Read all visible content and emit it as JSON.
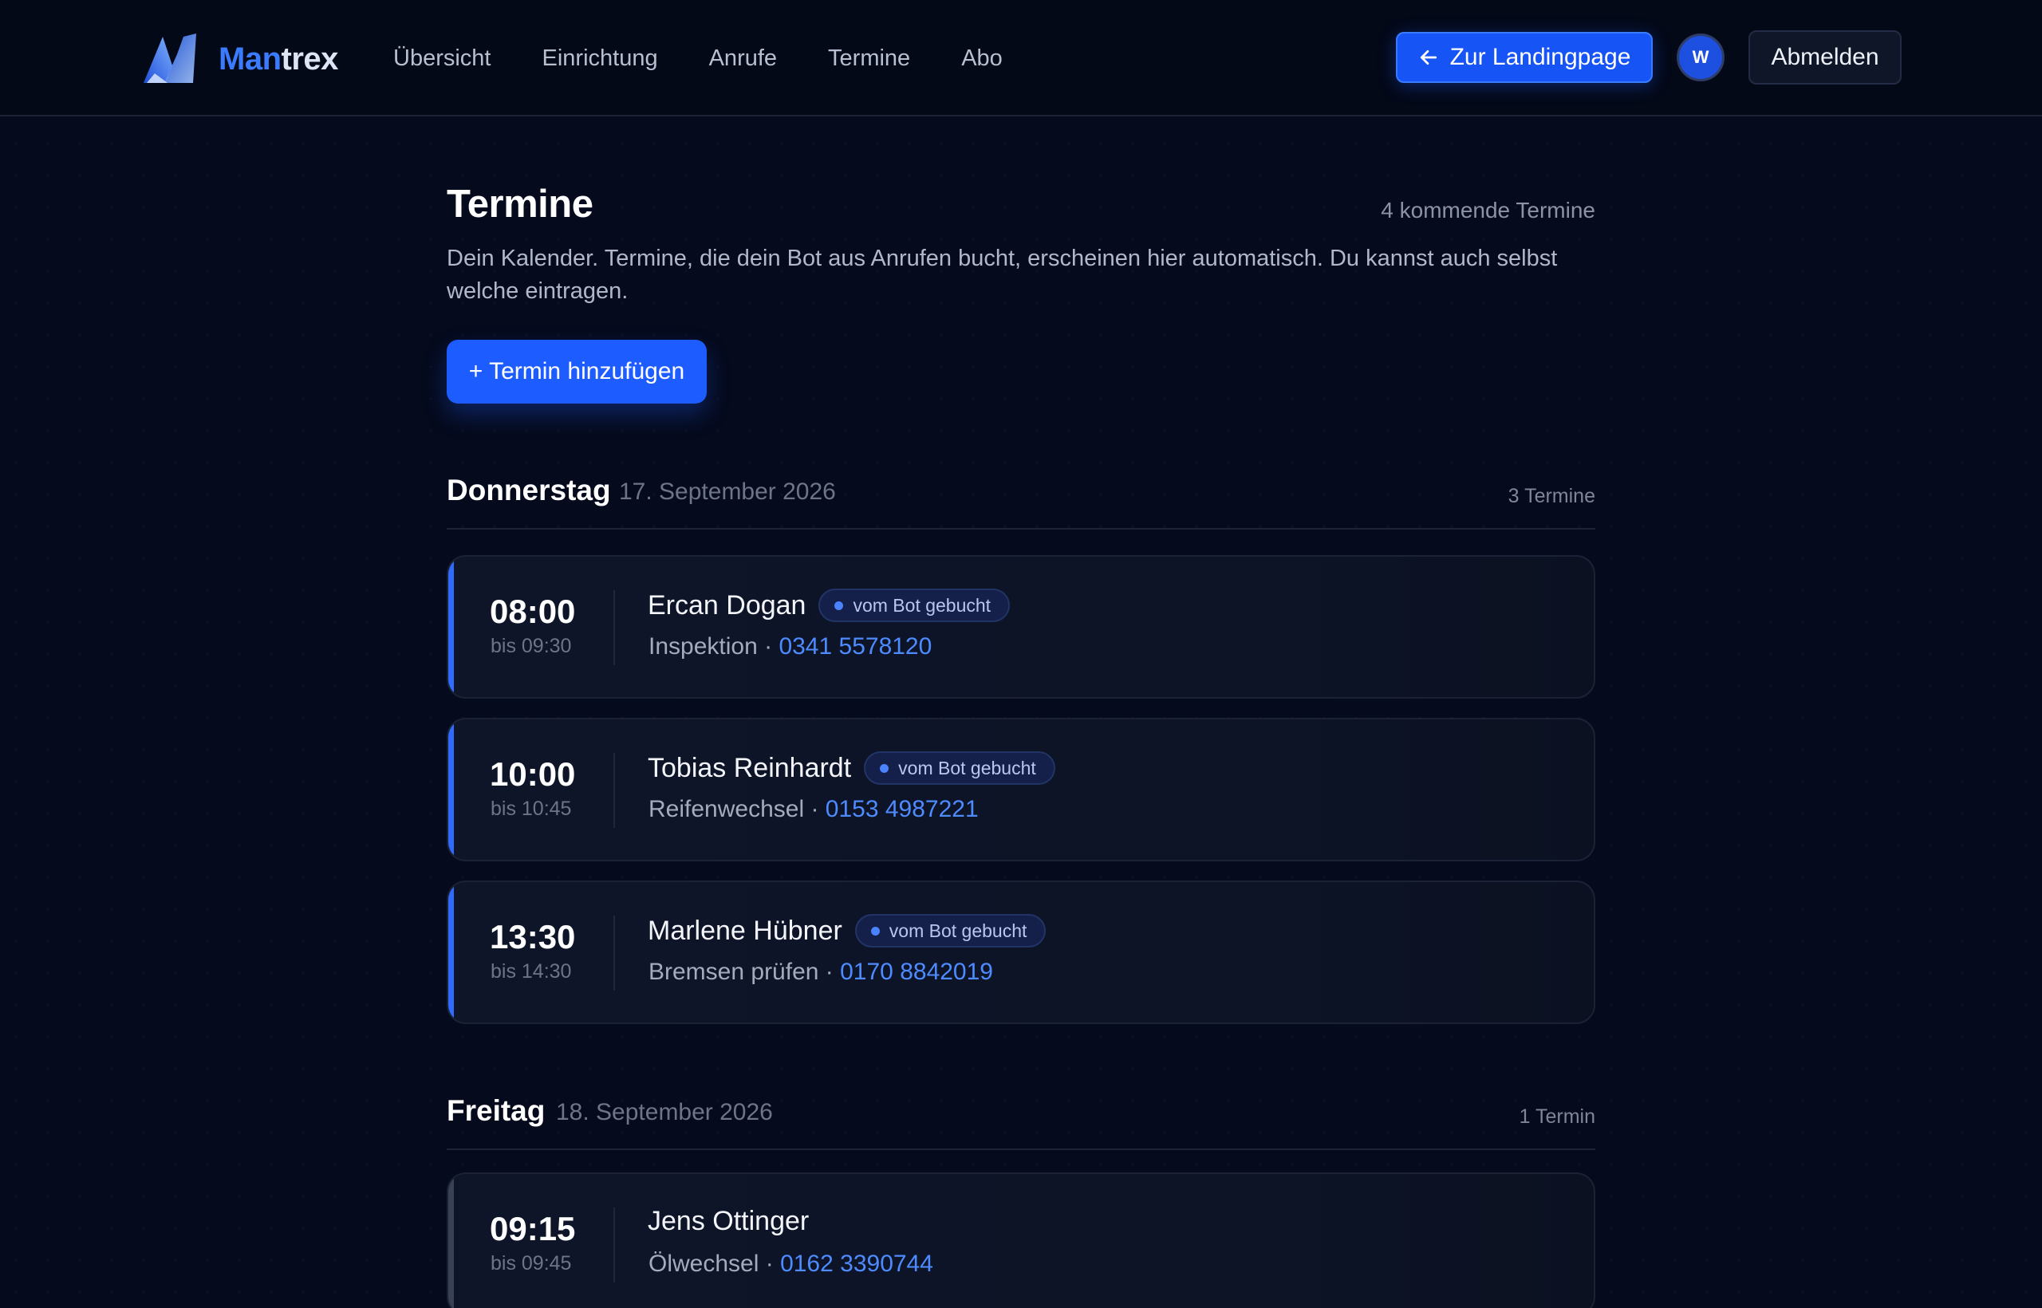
{
  "brand": {
    "name_part1": "Man",
    "name_part2": "trex"
  },
  "nav": {
    "items": [
      {
        "label": "Übersicht"
      },
      {
        "label": "Einrichtung"
      },
      {
        "label": "Anrufe"
      },
      {
        "label": "Termine"
      },
      {
        "label": "Abo"
      }
    ]
  },
  "header": {
    "landing_label": "Zur Landingpage",
    "avatar_initial": "W",
    "logout_label": "Abmelden"
  },
  "page": {
    "title": "Termine",
    "upcoming_count": "4 kommende Termine",
    "intro": "Dein Kalender. Termine, die dein Bot aus Anrufen bucht, erscheinen hier automatisch. Du kannst auch selbst welche eintragen.",
    "add_label": "+ Termin hinzufügen"
  },
  "days": [
    {
      "name": "Donnerstag",
      "date": "17. September 2026",
      "count": "3 Termine",
      "appointments": [
        {
          "time": "08:00",
          "until": "bis 09:30",
          "name": "Ercan Dogan",
          "badge": "vom Bot gebucht",
          "service": "Inspektion",
          "separator": " · ",
          "phone": "0341 5578120"
        },
        {
          "time": "10:00",
          "until": "bis 10:45",
          "name": "Tobias Reinhardt",
          "badge": "vom Bot gebucht",
          "service": "Reifenwechsel",
          "separator": " · ",
          "phone": "0153 4987221"
        },
        {
          "time": "13:30",
          "until": "bis 14:30",
          "name": "Marlene Hübner",
          "badge": "vom Bot gebucht",
          "service": "Bremsen prüfen",
          "separator": " · ",
          "phone": "0170 8842019"
        }
      ]
    },
    {
      "name": "Freitag",
      "date": "18. September 2026",
      "count": "1 Termin",
      "appointments": [
        {
          "time": "09:15",
          "until": "bis 09:45",
          "name": "Jens Ottinger",
          "service": "Ölwechsel",
          "separator": " · ",
          "phone": "0162 3390744"
        }
      ]
    }
  ],
  "colors": {
    "background": "#050a1c",
    "accent": "#1d5cff",
    "link": "#4d8bff",
    "bot_stripe": "#2f6bff",
    "manual_stripe": "#384156"
  },
  "icons": {
    "brand": "mantrex-logo-icon",
    "landing": "arrow-left-icon",
    "bot_badge": "dot-icon"
  }
}
